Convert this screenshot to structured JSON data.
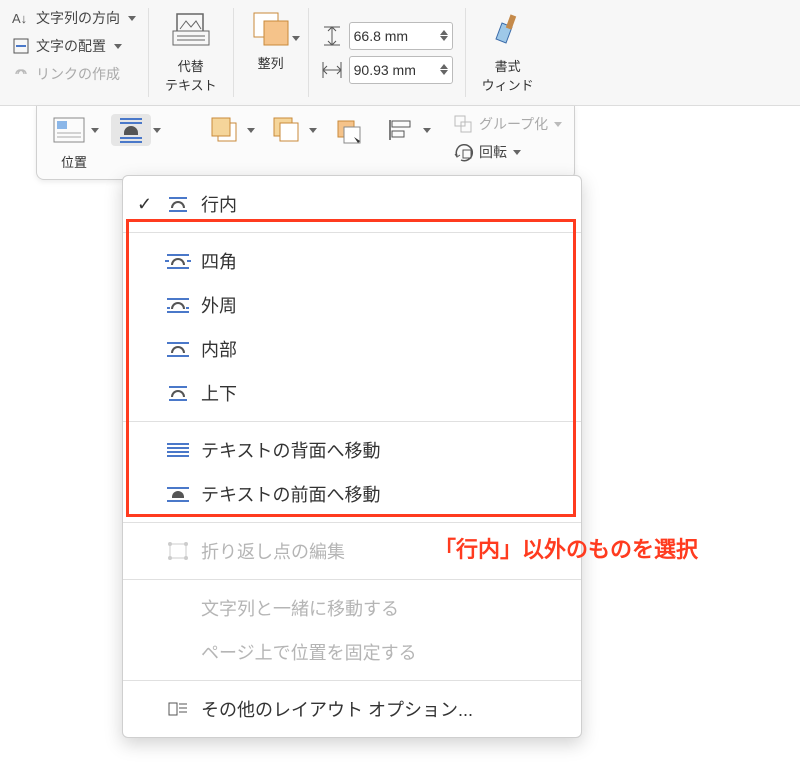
{
  "ribbon": {
    "text_direction": "文字列の方向",
    "text_align": "文字の配置",
    "create_link": "リンクの作成",
    "alt_text": "代替\nテキスト",
    "arrange": "整列",
    "format_window": "書式\nウィンド",
    "height_value": "66.8 mm",
    "width_value": "90.93 mm"
  },
  "toolbar": {
    "position": "位置",
    "group": "グループ化",
    "rotate": "回転"
  },
  "menu": {
    "inline": "行内",
    "square": "四角",
    "tight": "外周",
    "through": "内部",
    "topbottom": "上下",
    "behind": "テキストの背面へ移動",
    "front": "テキストの前面へ移動",
    "edit_wrap_points": "折り返し点の編集",
    "move_with_text": "文字列と一緒に移動する",
    "fix_position": "ページ上で位置を固定する",
    "more_options": "その他のレイアウト オプション..."
  },
  "annotation": "「行内」以外のものを選択"
}
